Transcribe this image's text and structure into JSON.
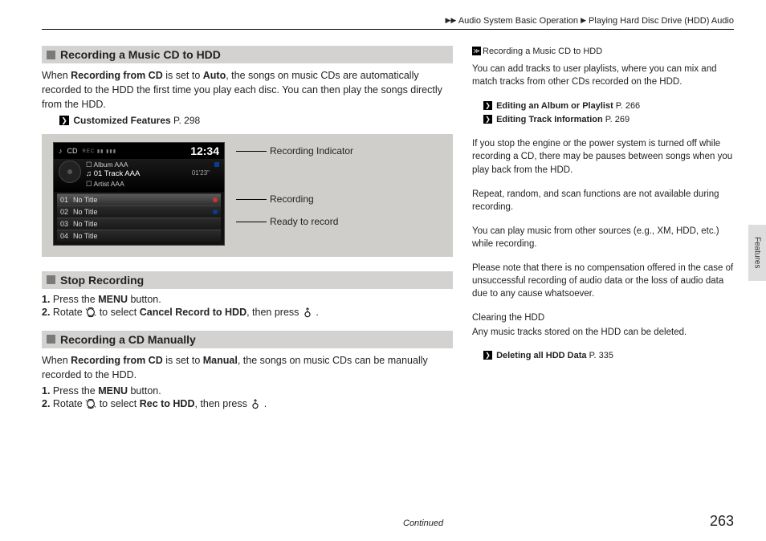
{
  "breadcrumb": {
    "arrow1": "▶▶",
    "part1": "Audio System Basic Operation",
    "arrow2": "▶",
    "part2": "Playing Hard Disc Drive (HDD) Audio"
  },
  "section1": {
    "title": "Recording a Music CD to HDD",
    "p1_a": "When ",
    "p1_bold1": "Recording from CD",
    "p1_b": " is set to ",
    "p1_bold2": "Auto",
    "p1_c": ", the songs on music CDs are automatically recorded to the HDD the first time you play each disc. You can then play the songs directly from the HDD.",
    "link1_label": "Customized Features",
    "link1_page": " P. 298"
  },
  "figure": {
    "screen": {
      "source": "CD",
      "bar_icons": "REC ▮▮ ▮▮▮",
      "clock": "12:34",
      "np_album": "☐ Album AAA",
      "np_track": "♫ 01 Track AAA",
      "np_artist": "☐ Artist AAA",
      "np_dur": "01'23\"",
      "tracks": [
        {
          "n": "01",
          "t": "No Title",
          "state": "red",
          "hi": true
        },
        {
          "n": "02",
          "t": "No Title",
          "state": "blue",
          "hi": false
        },
        {
          "n": "03",
          "t": "No Title",
          "state": "none",
          "hi": false
        },
        {
          "n": "04",
          "t": "No Title",
          "state": "none",
          "hi": false
        }
      ]
    },
    "callouts": {
      "c1": "Recording Indicator",
      "c2": "Recording",
      "c3": "Ready to record"
    }
  },
  "section2": {
    "title": "Stop Recording",
    "step1_a": "1. ",
    "step1_b": "Press the ",
    "step1_bold": "MENU",
    "step1_c": " button.",
    "step2_a": "2. ",
    "step2_b": "Rotate ",
    "step2_c": " to select ",
    "step2_bold": "Cancel Record to HDD",
    "step2_d": ", then press ",
    "step2_e": "."
  },
  "section3": {
    "title": "Recording a CD Manually",
    "p1_a": "When ",
    "p1_bold1": "Recording from CD",
    "p1_b": " is set to ",
    "p1_bold2": "Manual",
    "p1_c": ", the songs on music CDs can be manually recorded to the HDD.",
    "step1_a": "1. ",
    "step1_b": "Press the ",
    "step1_bold": "MENU",
    "step1_c": " button.",
    "step2_a": "2. ",
    "step2_b": "Rotate ",
    "step2_c": " to select ",
    "step2_bold": "Rec to HDD",
    "step2_d": ", then press ",
    "step2_e": "."
  },
  "sidebar": {
    "topic": "Recording a Music CD to HDD",
    "p1": "You can add tracks to user playlists, where you can mix and match tracks from other CDs recorded on the HDD.",
    "link1_label": "Editing an Album or Playlist",
    "link1_page": " P. 266",
    "link2_label": "Editing Track Information",
    "link2_page": " P. 269",
    "p2": "If you stop the engine or the power system is turned off while recording a CD, there may be pauses between songs when you play back from the HDD.",
    "p3": "Repeat, random, and scan functions are not available during recording.",
    "p4": "You can play music from other sources (e.g., XM, HDD, etc.) while recording.",
    "p5": "Please note that there is no compensation offered in the case of unsuccessful recording of audio data or the loss of audio data due to any cause whatsoever.",
    "p6_title": "Clearing the HDD",
    "p6": "Any music tracks stored on the HDD can be deleted.",
    "link3_label": "Deleting all HDD Data",
    "link3_page": " P. 335"
  },
  "tab": "Features",
  "footer": {
    "continued": "Continued",
    "page": "263"
  }
}
